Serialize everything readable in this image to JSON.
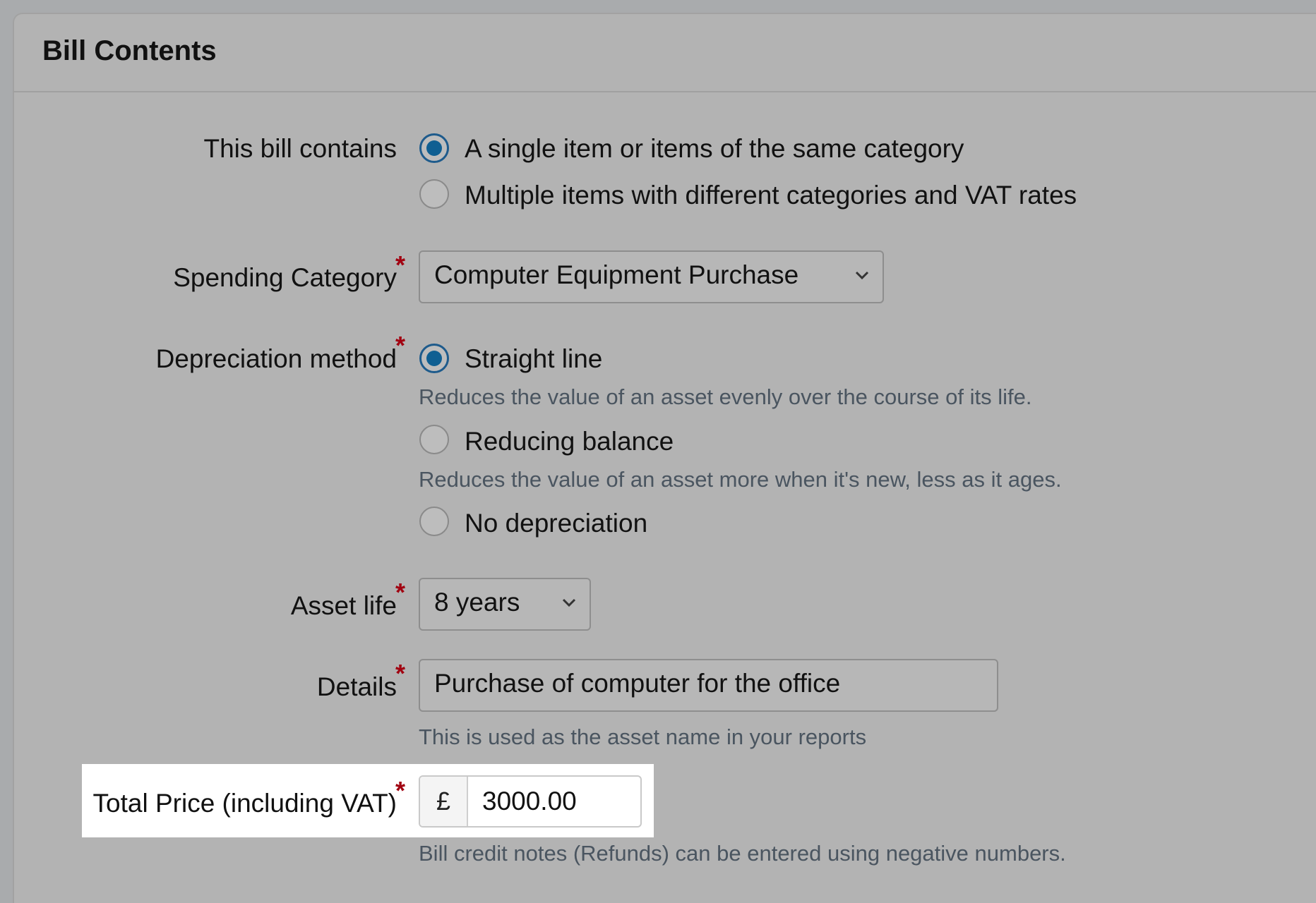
{
  "panel": {
    "title": "Bill Contents"
  },
  "bill_contains": {
    "label": "This bill contains",
    "options": [
      {
        "label": "A single item or items of the same category",
        "checked": true
      },
      {
        "label": "Multiple items with different categories and VAT rates",
        "checked": false
      }
    ]
  },
  "spending_category": {
    "label": "Spending Category",
    "required_mark": "*",
    "value": "Computer Equipment Purchase"
  },
  "depreciation": {
    "label": "Depreciation method",
    "required_mark": "*",
    "options": [
      {
        "label": "Straight line",
        "hint": "Reduces the value of an asset evenly over the course of its life.",
        "checked": true
      },
      {
        "label": "Reducing balance",
        "hint": "Reduces the value of an asset more when it's new, less as it ages.",
        "checked": false
      },
      {
        "label": "No depreciation",
        "hint": "",
        "checked": false
      }
    ]
  },
  "asset_life": {
    "label": "Asset life",
    "required_mark": "*",
    "value": "8 years"
  },
  "details": {
    "label": "Details",
    "required_mark": "*",
    "value": "Purchase of computer for the office",
    "hint": "This is used as the asset name in your reports"
  },
  "total_price": {
    "label": "Total Price (including VAT)",
    "required_mark": "*",
    "currency": "£",
    "value": "3000.00",
    "hint": "Bill credit notes (Refunds) can be entered using negative numbers."
  },
  "colors": {
    "accent": "#0f5f92",
    "required": "#a10010",
    "hint": "#4a5560"
  }
}
